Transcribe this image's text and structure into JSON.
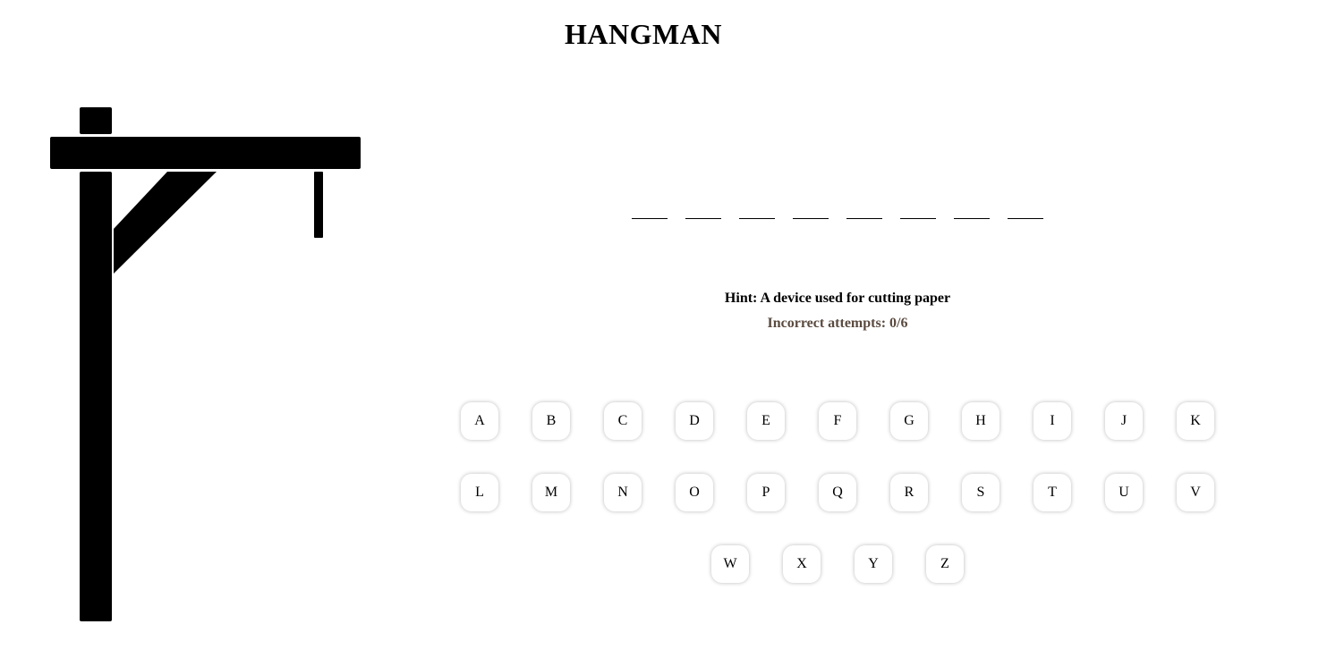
{
  "title": "HANGMAN",
  "word": {
    "letters": [
      "",
      "",
      "",
      "",
      "",
      "",
      "",
      ""
    ]
  },
  "hint": "Hint: A device used for cutting paper",
  "attempts": "Incorrect attempts: 0/6",
  "keyboard": {
    "rows": [
      [
        "A",
        "B",
        "C",
        "D",
        "E",
        "F",
        "G",
        "H",
        "I",
        "J",
        "K"
      ],
      [
        "L",
        "M",
        "N",
        "O",
        "P",
        "Q",
        "R",
        "S",
        "T",
        "U",
        "V"
      ],
      [
        "W",
        "X",
        "Y",
        "Z"
      ]
    ]
  },
  "colors": {
    "gallows": "#000000",
    "attempts_text": "#5a4a3f",
    "background": "#ffffff"
  }
}
